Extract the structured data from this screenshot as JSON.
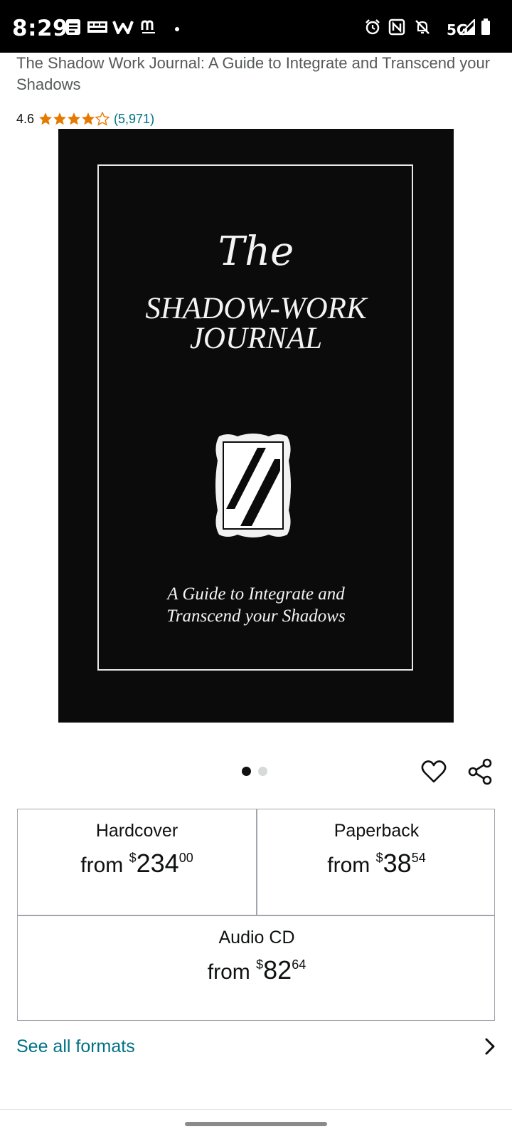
{
  "status_bar": {
    "time": "8:29",
    "network": "5G",
    "left_icons": [
      "notes-icon",
      "app-icon",
      "w-icon",
      "m-zone-icon"
    ],
    "right_icons": [
      "alarm-icon",
      "nfc-icon",
      "bell-off-icon",
      "signal-icon",
      "battery-icon"
    ]
  },
  "product": {
    "title": "The Shadow Work Journal: A Guide to Integrate and Transcend your Shadows",
    "rating_value": "4.6",
    "rating_stars": 4.6,
    "rating_count": "(5,971)"
  },
  "cover": {
    "the": "The",
    "title_line1": "SHADOW-WORK",
    "title_line2": "JOURNAL",
    "subtitle_line1": "A Guide to Integrate and",
    "subtitle_line2": "Transcend your Shadows",
    "image_count": 2,
    "active_image": 1
  },
  "formats": {
    "hardcover": {
      "name": "Hardcover",
      "from": "from",
      "currency": "$",
      "whole": "234",
      "cents": "00"
    },
    "paperback": {
      "name": "Paperback",
      "from": "from",
      "currency": "$",
      "whole": "38",
      "cents": "54"
    },
    "audio_cd": {
      "name": "Audio CD",
      "from": "from",
      "currency": "$",
      "whole": "82",
      "cents": "64"
    }
  },
  "see_all": {
    "label": "See all formats"
  },
  "colors": {
    "link": "#007185",
    "star": "#e67a00",
    "border": "#a2a6ac"
  }
}
